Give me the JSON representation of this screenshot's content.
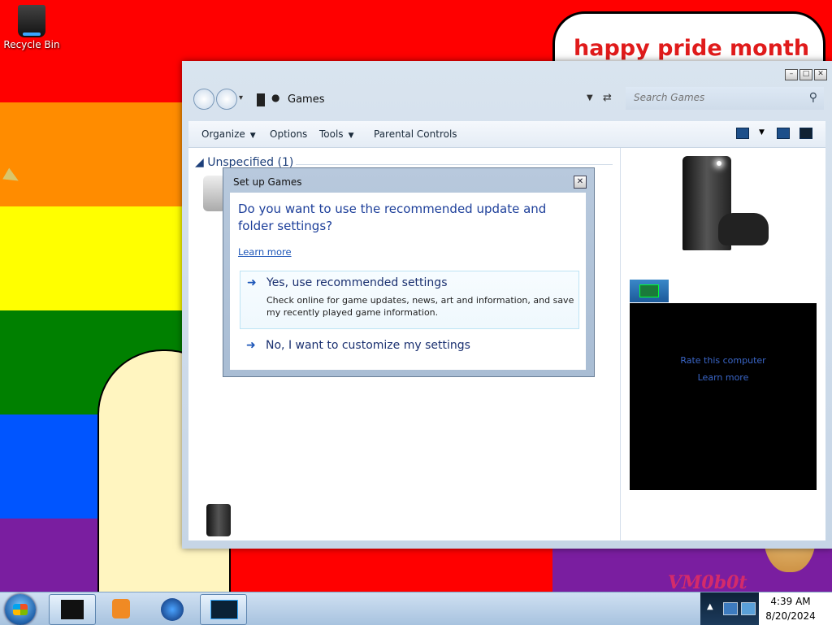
{
  "desktop": {
    "stripe_colors": [
      "#ff0000",
      "#ff8c00",
      "#ffff00",
      "#008000",
      "#0055ff",
      "#7a1ea0"
    ],
    "recycle_bin_label": "Recycle Bin",
    "bubble_text": "happy pride month",
    "watermark": "VM0b0t"
  },
  "window": {
    "address": {
      "path_label": "Games",
      "search_placeholder": "Search Games"
    },
    "toolbar": {
      "organize": "Organize",
      "options": "Options",
      "tools": "Tools",
      "parental_controls": "Parental Controls"
    },
    "group_header": "Unspecified (1)",
    "wei": {
      "rate_link": "Rate this computer",
      "learn_more": "Learn more"
    }
  },
  "dialog": {
    "title": "Set up Games",
    "question": "Do you want to use the recommended update and folder settings?",
    "learn_more": "Learn more",
    "options": [
      {
        "title": "Yes, use recommended settings",
        "description": "Check online for game updates, news, art and information, and save my recently played game information."
      },
      {
        "title": "No, I want to customize my settings",
        "description": ""
      }
    ]
  },
  "taskbar": {
    "time": "4:39 AM",
    "date": "8/20/2024"
  },
  "icons": {
    "window_ctrls": [
      "minimize-icon",
      "maximize-icon",
      "close-icon"
    ],
    "option_arrow": "arrow-right-icon",
    "search": "search-icon"
  }
}
